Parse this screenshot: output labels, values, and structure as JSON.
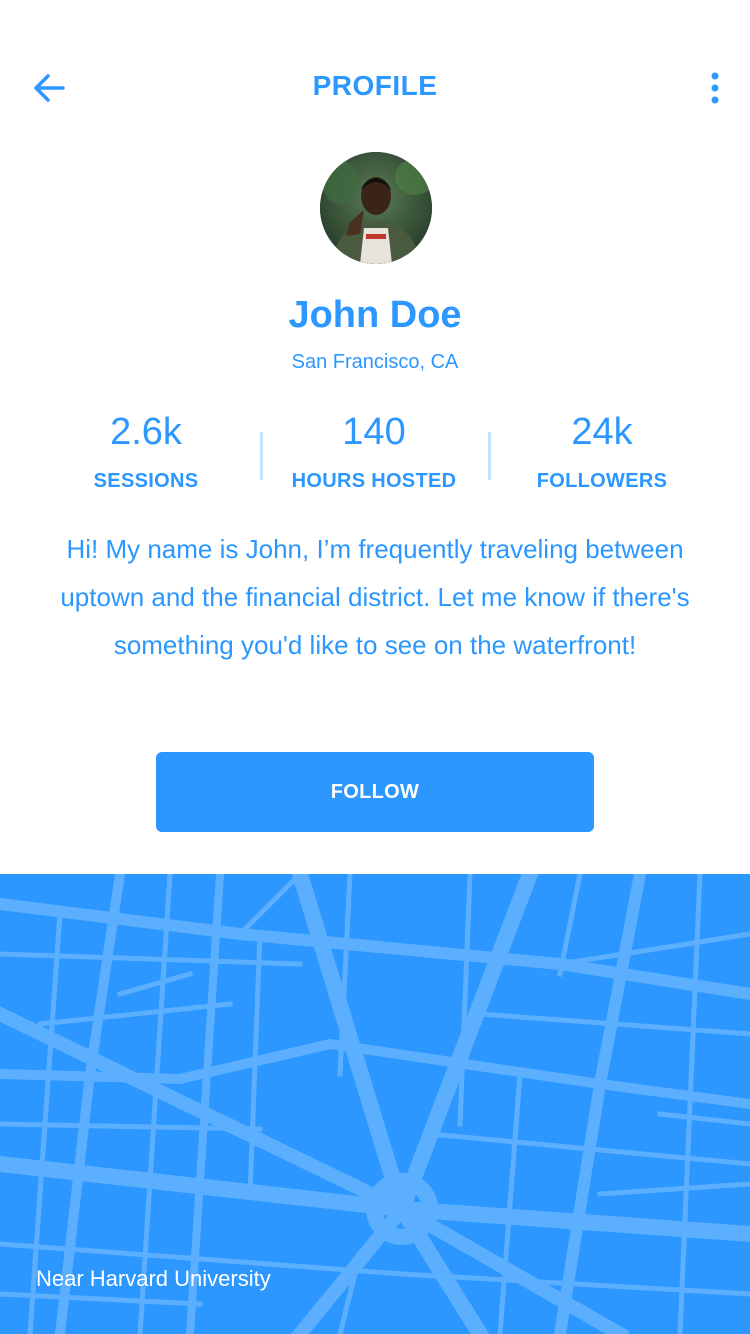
{
  "header": {
    "title": "PROFILE",
    "back_icon": "arrow-left-icon",
    "more_icon": "more-vertical-icon"
  },
  "profile": {
    "name": "John Doe",
    "location": "San Francisco, CA",
    "bio": "Hi! My name is John, I’m frequently traveling between uptown and the financial district. Let me know if there's something you'd like to see on the waterfront!"
  },
  "stats": [
    {
      "value": "2.6k",
      "label": "SESSIONS"
    },
    {
      "value": "140",
      "label": "HOURS HOSTED"
    },
    {
      "value": "24k",
      "label": "FOLLOWERS"
    }
  ],
  "follow_button": {
    "label": "FOLLOW"
  },
  "map": {
    "label": "Near Harvard University"
  },
  "colors": {
    "accent": "#2b97ff",
    "map_road": "#5cafff",
    "divider": "#c9e2fb",
    "background": "#ffffff"
  }
}
